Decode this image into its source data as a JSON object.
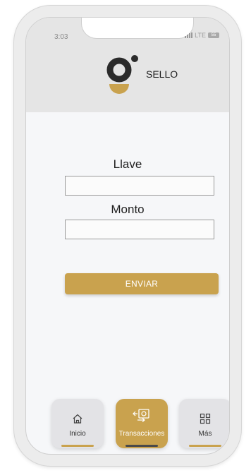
{
  "status_bar": {
    "time": "3:03",
    "network": "LTE",
    "battery": "55"
  },
  "brand": {
    "name": "SELLO"
  },
  "form": {
    "key_label": "Llave",
    "key_value": "",
    "amount_label": "Monto",
    "amount_value": "",
    "submit_label": "ENVIAR"
  },
  "bottom_nav": {
    "items": [
      {
        "label": "Inicio",
        "icon": "home-icon",
        "active": false
      },
      {
        "label": "Transacciones",
        "icon": "money-transfer-icon",
        "active": true
      },
      {
        "label": "Más",
        "icon": "grid-icon",
        "active": false
      }
    ]
  },
  "colors": {
    "accent": "#c9a24e",
    "header_bg": "#e5e5e5",
    "screen_bg": "#f6f7f9",
    "logo_dark": "#2b2b2b"
  }
}
